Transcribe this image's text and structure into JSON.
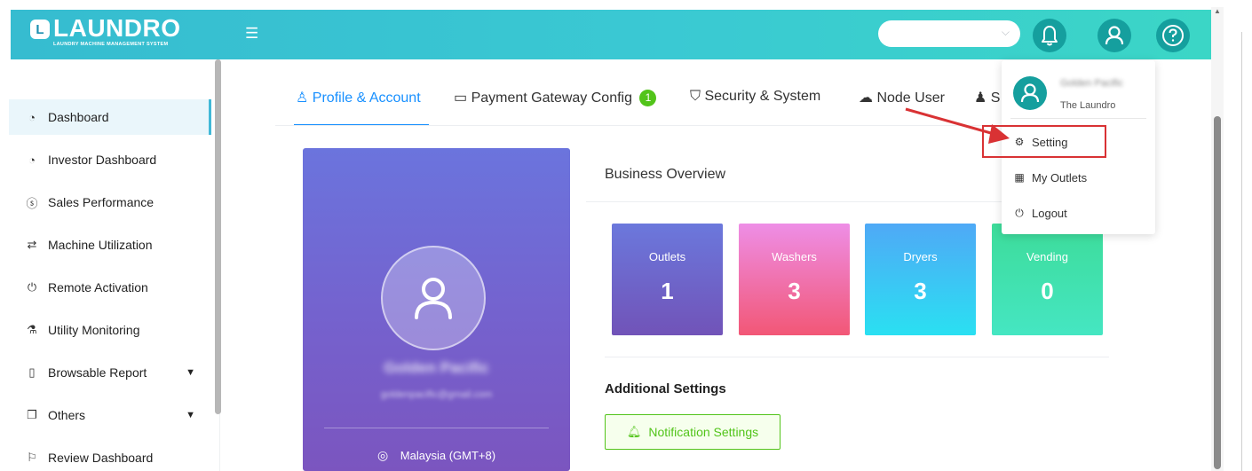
{
  "header": {
    "logo_text": "LAUNDRO",
    "logo_badge": "L",
    "logo_subtitle": "LAUNDRY MACHINE MANAGEMENT SYSTEM",
    "outlet_select_value": ""
  },
  "sidebar": {
    "items": [
      {
        "label": "Dashboard",
        "icon": "dashboard-icon",
        "active": true
      },
      {
        "label": "Investor Dashboard",
        "icon": "dashboard-icon"
      },
      {
        "label": "Sales Performance",
        "icon": "dollar-circle-icon"
      },
      {
        "label": "Machine Utilization",
        "icon": "swap-icon"
      },
      {
        "label": "Remote Activation",
        "icon": "power-icon"
      },
      {
        "label": "Utility Monitoring",
        "icon": "flask-icon"
      },
      {
        "label": "Browsable Report",
        "icon": "report-icon",
        "has_submenu": true
      },
      {
        "label": "Others",
        "icon": "copy-icon",
        "has_submenu": true
      },
      {
        "label": "Review Dashboard",
        "icon": "review-icon"
      }
    ]
  },
  "tabs": [
    {
      "label": "Profile & Account",
      "icon": "user-icon",
      "active": true
    },
    {
      "label": "Payment Gateway Config",
      "icon": "credit-card-icon",
      "badge": "1"
    },
    {
      "label": "Security & System",
      "icon": "shield-icon"
    },
    {
      "label": "Node User",
      "icon": "cloud-icon"
    },
    {
      "label": "S",
      "icon": "team-icon"
    }
  ],
  "profile": {
    "name": "Golden Pacific",
    "email": "goldenpacific@gmail.com",
    "location": "Malaysia (GMT+8)"
  },
  "business_overview": {
    "title": "Business Overview",
    "stats": [
      {
        "label": "Outlets",
        "value": "1",
        "gradient": [
          "#6b78dc",
          "#7153b8"
        ]
      },
      {
        "label": "Washers",
        "value": "3",
        "gradient": [
          "#ee8ee6",
          "#f25776"
        ]
      },
      {
        "label": "Dryers",
        "value": "3",
        "gradient": [
          "#4fa9f6",
          "#2ae0f2"
        ]
      },
      {
        "label": "Vending",
        "value": "0",
        "gradient": [
          "#3ddc9a",
          "#45e6c2"
        ]
      }
    ]
  },
  "additional_settings": {
    "title": "Additional Settings",
    "notification_button": "Notification Settings"
  },
  "user_menu": {
    "name": "Golden Pacific",
    "company": "The Laundro",
    "items": [
      {
        "label": "Setting",
        "icon": "gear-icon",
        "highlighted": true
      },
      {
        "label": "My Outlets",
        "icon": "store-icon"
      },
      {
        "label": "Logout",
        "icon": "power-icon"
      }
    ]
  },
  "colors": {
    "header_gradient": [
      "#36bcd0",
      "#3bd6c6"
    ],
    "accent": "#1890ff",
    "badge_green": "#52c41a",
    "annotation_red": "#d93234",
    "avatar_teal": "#159f9e"
  }
}
